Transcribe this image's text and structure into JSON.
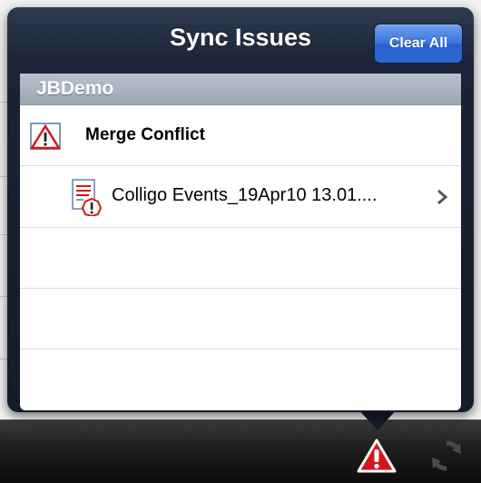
{
  "popover": {
    "title": "Sync Issues",
    "clear_all_label": "Clear All"
  },
  "sections": [
    {
      "header": "JBDemo",
      "conflict_label": "Merge Conflict",
      "item_label": "Colligo Events_19Apr10 13.01...."
    }
  ],
  "toolbar": {
    "icons": [
      "warning-icon",
      "sync-icon"
    ]
  },
  "colors": {
    "popover_bg": "#141b29",
    "button_blue": "#3a74dc",
    "warning_red": "#d4161c",
    "section_header": "#a8b3bf"
  }
}
